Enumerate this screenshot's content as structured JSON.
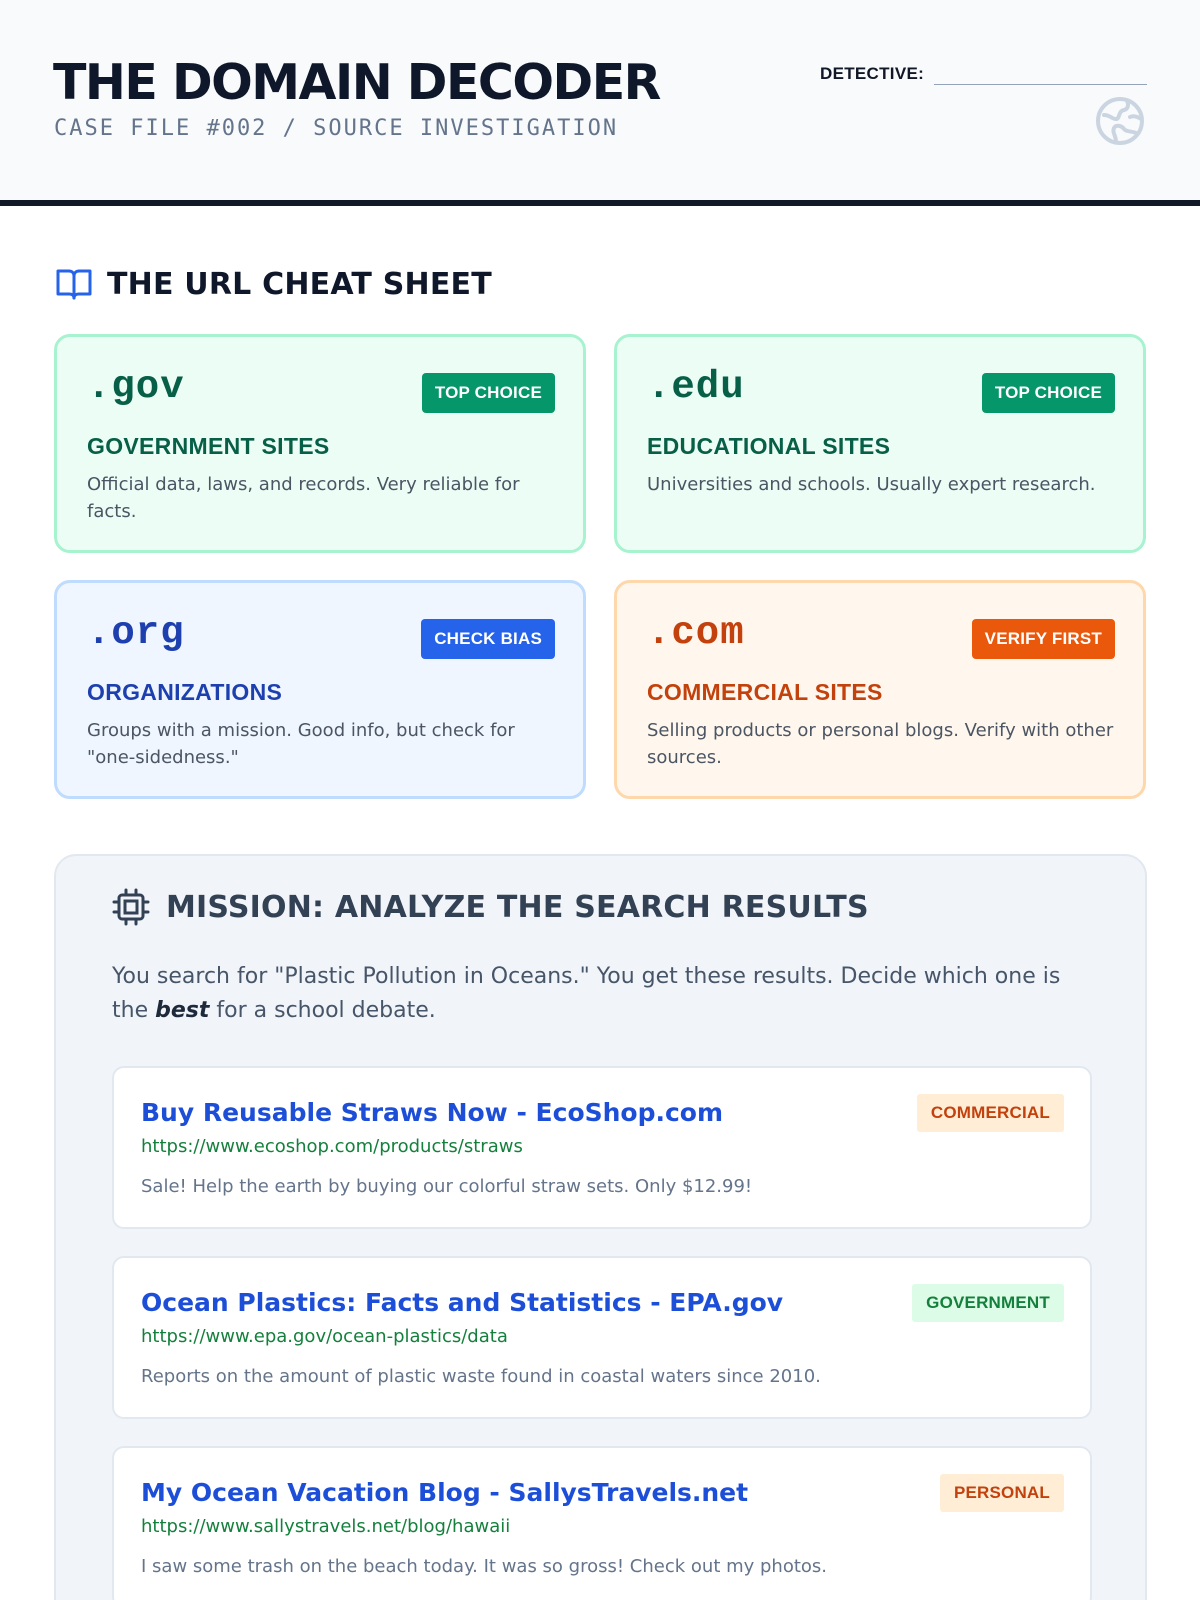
{
  "header": {
    "title": "THE DOMAIN DECODER",
    "subtitle": "CASE FILE #002 / SOURCE INVESTIGATION",
    "detective_label": "DETECTIVE:"
  },
  "cheat_sheet": {
    "heading": "THE URL CHEAT SHEET",
    "cards": [
      {
        "tld": ".gov",
        "badge": "TOP CHOICE",
        "title": "GOVERNMENT SITES",
        "description": "Official data, laws, and records. Very reliable for facts.",
        "color": "#059669"
      },
      {
        "tld": ".edu",
        "badge": "TOP CHOICE",
        "title": "EDUCATIONAL SITES",
        "description": "Universities and schools. Usually expert research.",
        "color": "#059669"
      },
      {
        "tld": ".org",
        "badge": "CHECK BIAS",
        "title": "ORGANIZATIONS",
        "description": "Groups with a mission. Good info, but check for \"one-sidedness.\"",
        "color": "#2563eb"
      },
      {
        "tld": ".com",
        "badge": "VERIFY FIRST",
        "title": "COMMERCIAL SITES",
        "description": "Selling products or personal blogs. Verify with other sources.",
        "color": "#ea580c"
      }
    ]
  },
  "mission": {
    "heading": "MISSION: ANALYZE THE SEARCH RESULTS",
    "intro_before": "You search for \"Plastic Pollution in Oceans.\" You get these results. Decide which one is the ",
    "intro_emphasis": "best",
    "intro_after": " for a school debate.",
    "results": [
      {
        "title": "Buy Reusable Straws Now - EcoShop.com",
        "url": "https://www.ecoshop.com/products/straws",
        "snippet": "Sale! Help the earth by buying our colorful straw sets. Only $12.99!",
        "tag": "COMMERCIAL"
      },
      {
        "title": "Ocean Plastics: Facts and Statistics - EPA.gov",
        "url": "https://www.epa.gov/ocean-plastics/data",
        "snippet": "Reports on the amount of plastic waste found in coastal waters since 2010.",
        "tag": "GOVERNMENT"
      },
      {
        "title": "My Ocean Vacation Blog - SallysTravels.net",
        "url": "https://www.sallystravels.net/blog/hawaii",
        "snippet": "I saw some trash on the beach today. It was so gross! Check out my photos.",
        "tag": "PERSONAL"
      }
    ]
  }
}
